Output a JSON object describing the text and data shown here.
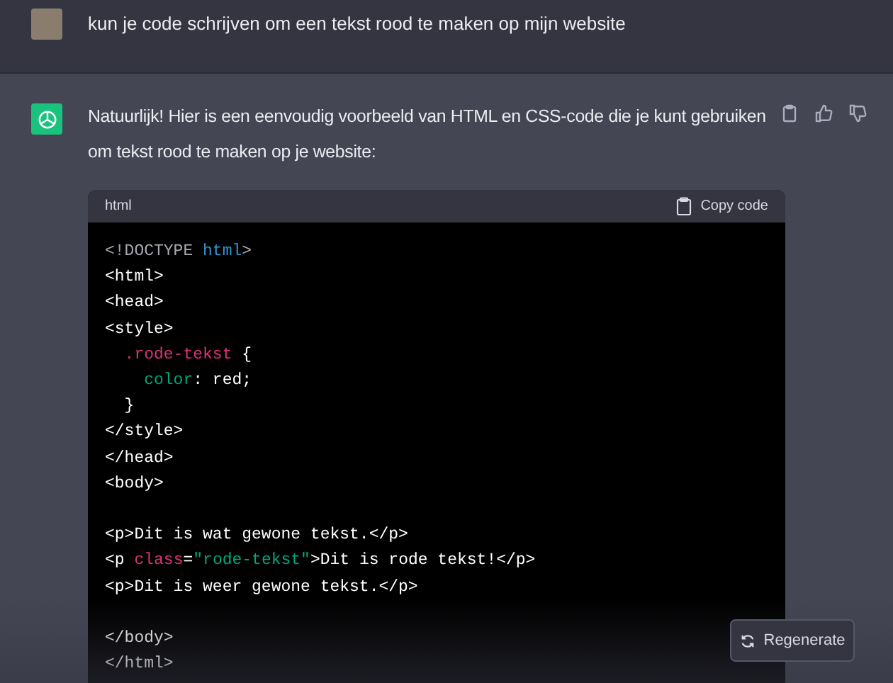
{
  "user_message": {
    "text": "kun je code schrijven om een tekst rood te maken op mijn website"
  },
  "assistant_message": {
    "text": "Natuurlijk! Hier is een eenvoudig voorbeeld van HTML en CSS-code die je kunt gebruiken om tekst rood te maken op je website:",
    "code_block": {
      "language": "html",
      "copy_label": "Copy code",
      "lines": [
        {
          "gap_before": false,
          "tokens": [
            {
              "kind": "meta",
              "text": "<!DOCTYPE "
            },
            {
              "kind": "keyword",
              "text": "html"
            },
            {
              "kind": "meta",
              "text": ">"
            }
          ]
        },
        {
          "gap_before": false,
          "tokens": [
            {
              "kind": "plain",
              "text": "<html>"
            }
          ]
        },
        {
          "gap_before": false,
          "tokens": [
            {
              "kind": "plain",
              "text": "<head>"
            }
          ]
        },
        {
          "gap_before": false,
          "tokens": [
            {
              "kind": "plain",
              "text": "<style>"
            }
          ]
        },
        {
          "gap_before": false,
          "tokens": [
            {
              "kind": "selector",
              "text": "  .rode-tekst"
            },
            {
              "kind": "plain",
              "text": " {"
            }
          ]
        },
        {
          "gap_before": false,
          "tokens": [
            {
              "kind": "property",
              "text": "    color"
            },
            {
              "kind": "plain",
              "text": ": red;"
            }
          ]
        },
        {
          "gap_before": false,
          "tokens": [
            {
              "kind": "plain",
              "text": "  }"
            }
          ]
        },
        {
          "gap_before": false,
          "tokens": [
            {
              "kind": "plain",
              "text": "</style>"
            }
          ]
        },
        {
          "gap_before": false,
          "tokens": [
            {
              "kind": "plain",
              "text": "</head>"
            }
          ]
        },
        {
          "gap_before": false,
          "tokens": [
            {
              "kind": "plain",
              "text": "<body>"
            }
          ]
        },
        {
          "gap_before": true,
          "tokens": [
            {
              "kind": "plain",
              "text": "<p>Dit is wat gewone tekst.</p>"
            }
          ]
        },
        {
          "gap_before": false,
          "tokens": [
            {
              "kind": "plain",
              "text": "<p "
            },
            {
              "kind": "attribute",
              "text": "class"
            },
            {
              "kind": "plain",
              "text": "="
            },
            {
              "kind": "string",
              "text": "\"rode-tekst\""
            },
            {
              "kind": "plain",
              "text": ">Dit is rode tekst!</p>"
            }
          ]
        },
        {
          "gap_before": false,
          "tokens": [
            {
              "kind": "plain",
              "text": "<p>Dit is weer gewone tekst.</p>"
            }
          ]
        },
        {
          "gap_before": true,
          "tokens": [
            {
              "kind": "plain",
              "text": "</body>"
            }
          ]
        },
        {
          "gap_before": false,
          "tokens": [
            {
              "kind": "plain",
              "text": "</html>"
            }
          ]
        }
      ]
    }
  },
  "regenerate_button": {
    "label": "Regenerate"
  }
}
